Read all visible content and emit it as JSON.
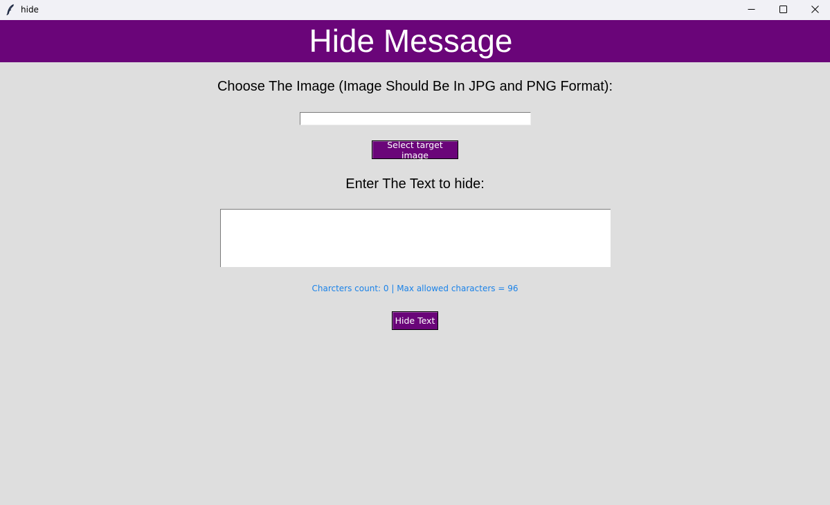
{
  "window": {
    "title": "hide",
    "app_icon": "feather-icon",
    "controls": {
      "minimize_icon": "minimize-icon",
      "maximize_icon": "maximize-icon",
      "close_icon": "close-icon"
    }
  },
  "header": {
    "title": "Hide Message",
    "background_color": "#6a0579"
  },
  "choose_image": {
    "label": "Choose The Image (Image Should Be In JPG and PNG Format):",
    "path_value": "",
    "button_label": "Select target image"
  },
  "text_entry": {
    "label": "Enter The Text to hide:",
    "value": ""
  },
  "char_count": {
    "prefix": "Charcters count: ",
    "count": "0",
    "separator": " | ",
    "max_text": "Max allowed characters = ",
    "max": "96",
    "color": "#1a82e8"
  },
  "hide_button": {
    "label": "Hide Text"
  }
}
